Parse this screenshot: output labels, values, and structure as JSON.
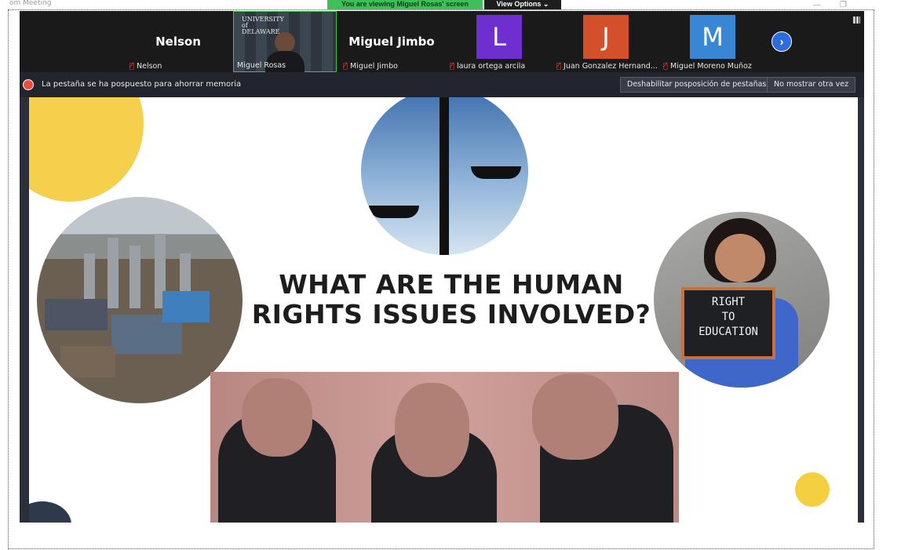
{
  "window": {
    "title": "om Meeting"
  },
  "banner": {
    "viewing_text": "You are viewing Miguel Rosas' screen",
    "view_options_label": "View Options ⌄"
  },
  "participants": [
    {
      "display": "Nelson",
      "label": "Nelson",
      "muted": true,
      "type": "name"
    },
    {
      "display": "",
      "label": "Miguel Rosas",
      "muted": false,
      "type": "video"
    },
    {
      "display": "Miguel Jimbo",
      "label": "Miguel Jimbo",
      "muted": true,
      "type": "name"
    },
    {
      "display": "L",
      "label": "laura ortega arcila",
      "muted": true,
      "type": "avatar",
      "color": "#6f2fd0"
    },
    {
      "display": "J",
      "label": "Juan Gonzalez Hernand...",
      "muted": true,
      "type": "avatar",
      "color": "#d4502a"
    },
    {
      "display": "M",
      "label": "Miguel Moreno Muñoz",
      "muted": true,
      "type": "avatar",
      "color": "#3a86d6"
    }
  ],
  "video_logo": "UNIVERSITY of DELAWARE",
  "notice": {
    "message": "La pestaña se ha pospuesto para ahorrar memoria",
    "disable_button": "Deshabilitar posposición de pestañas",
    "dont_show_button": "No mostrar otra vez"
  },
  "slide": {
    "title_line1": "WHAT ARE THE HUMAN",
    "title_line2": "RIGHTS ISSUES INVOLVED?",
    "sign_lines": [
      "RIGHT",
      "TO",
      "EDUCATION"
    ]
  },
  "colors": {
    "accent_yellow": "#f6d04d",
    "strip_bg": "#1a1a1a",
    "mute_red": "#e0412f",
    "video_border": "#38c440"
  },
  "icons": {
    "mute": "microphone-muted-icon",
    "next": "chevron-right-icon",
    "grid": "grid-view-icon"
  }
}
